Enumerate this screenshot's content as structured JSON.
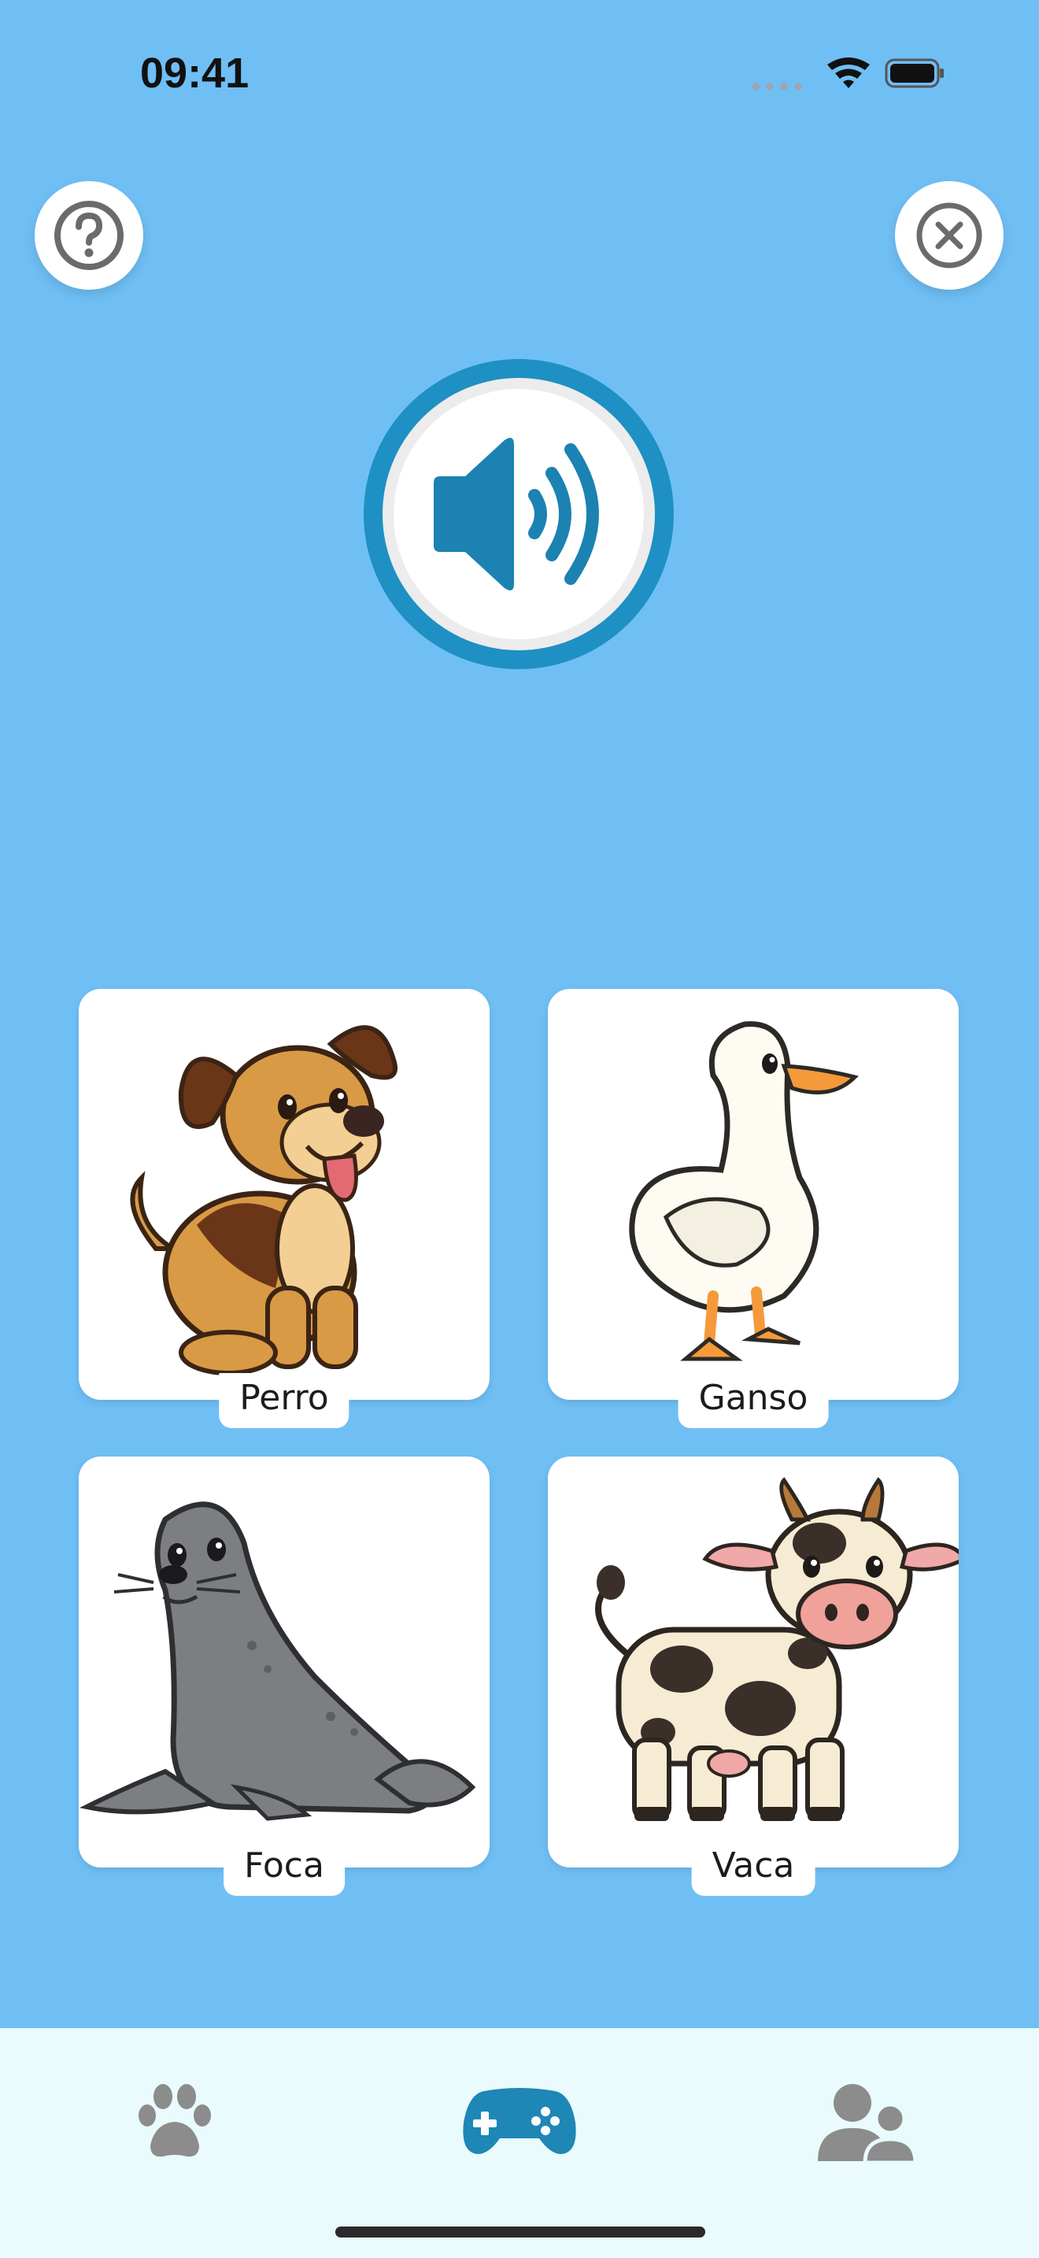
{
  "status_bar": {
    "time": "09:41",
    "icons": [
      "cellular-icon",
      "wifi-icon",
      "battery-icon"
    ]
  },
  "header": {
    "help_icon": "question-icon",
    "close_icon": "close-icon"
  },
  "play_sound": {
    "icon": "speaker-icon"
  },
  "options": [
    {
      "label": "Perro",
      "image": "dog-illustration"
    },
    {
      "label": "Ganso",
      "image": "goose-illustration"
    },
    {
      "label": "Foca",
      "image": "seal-illustration"
    },
    {
      "label": "Vaca",
      "image": "cow-illustration"
    }
  ],
  "tab_bar": {
    "tabs": [
      {
        "icon": "paw-icon",
        "active": false
      },
      {
        "icon": "gamepad-icon",
        "active": true
      },
      {
        "icon": "profiles-icon",
        "active": false
      }
    ]
  },
  "colors": {
    "background": "#6fbff5",
    "accent": "#1e87b6",
    "tab_inactive": "#8c8c8c",
    "tab_bar": "#e9fbfc"
  }
}
